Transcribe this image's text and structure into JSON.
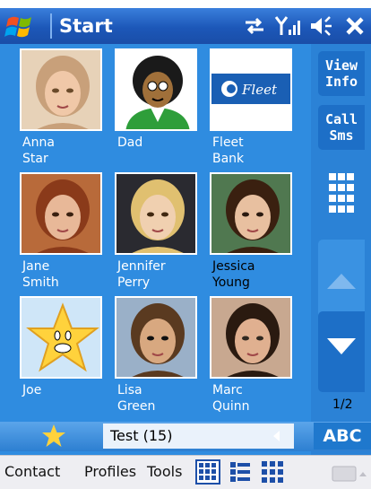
{
  "titlebar": {
    "title": "Start"
  },
  "contacts": [
    {
      "first": "Anna",
      "last": "Star",
      "kind": "woman-blonde",
      "selected": false
    },
    {
      "first": "Dad",
      "last": "",
      "kind": "avatar-afro",
      "selected": false
    },
    {
      "first": "Fleet",
      "last": "Bank",
      "kind": "logo-fleet",
      "logo_text": "Fleet",
      "selected": false
    },
    {
      "first": "Jane",
      "last": "Smith",
      "kind": "woman-red",
      "selected": false
    },
    {
      "first": "Jennifer",
      "last": "Perry",
      "kind": "woman-blonde-long",
      "selected": false
    },
    {
      "first": "Jessica",
      "last": "Young",
      "kind": "woman-dark",
      "selected": true
    },
    {
      "first": "Joe",
      "last": "",
      "kind": "star-icon",
      "selected": false
    },
    {
      "first": "Lisa",
      "last": "Green",
      "kind": "woman-sunglasses",
      "selected": false
    },
    {
      "first": "Marc",
      "last": "Quinn",
      "kind": "man-phone",
      "selected": false
    }
  ],
  "sidebar": {
    "view_info_line1": "View",
    "view_info_line2": "Info",
    "call_sms_line1": "Call",
    "call_sms_line2": "Sms",
    "page_indicator": "1/2"
  },
  "bottombar": {
    "search_text": "Test (15)",
    "abc_label": "ABC"
  },
  "menubar": {
    "contact": "Contact",
    "profiles": "Profiles",
    "tools": "Tools"
  },
  "colors": {
    "accent": "#2f8ce0",
    "title": "#1c57b8"
  }
}
